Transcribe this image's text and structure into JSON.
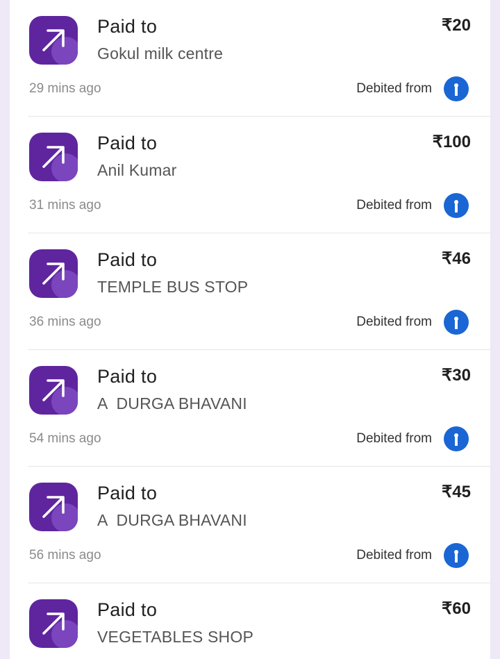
{
  "transactions": [
    {
      "title": "Paid to",
      "payee": "Gokul milk centre",
      "amount": "₹20",
      "time": "29 mins ago",
      "debited_label": "Debited from",
      "bank_icon": "bank-logo-icon"
    },
    {
      "title": "Paid to",
      "payee": "Anil Kumar",
      "amount": "₹100",
      "time": "31 mins ago",
      "debited_label": "Debited from",
      "bank_icon": "bank-logo-icon"
    },
    {
      "title": "Paid to",
      "payee": "TEMPLE BUS STOP",
      "amount": "₹46",
      "time": "36 mins ago",
      "debited_label": "Debited from",
      "bank_icon": "bank-logo-icon"
    },
    {
      "title": "Paid to",
      "payee": "A  DURGA BHAVANI",
      "amount": "₹30",
      "time": "54 mins ago",
      "debited_label": "Debited from",
      "bank_icon": "bank-logo-icon"
    },
    {
      "title": "Paid to",
      "payee": "A  DURGA BHAVANI",
      "amount": "₹45",
      "time": "56 mins ago",
      "debited_label": "Debited from",
      "bank_icon": "bank-logo-icon"
    },
    {
      "title": "Paid to",
      "payee": "VEGETABLES SHOP",
      "amount": "₹60",
      "time": "",
      "debited_label": "",
      "bank_icon": ""
    }
  ],
  "colors": {
    "app_icon": "#5f259f",
    "bank_icon": "#1a66d4",
    "background": "#efe8f7"
  },
  "icons": {
    "paid_icon": "arrow-up-right-icon"
  }
}
